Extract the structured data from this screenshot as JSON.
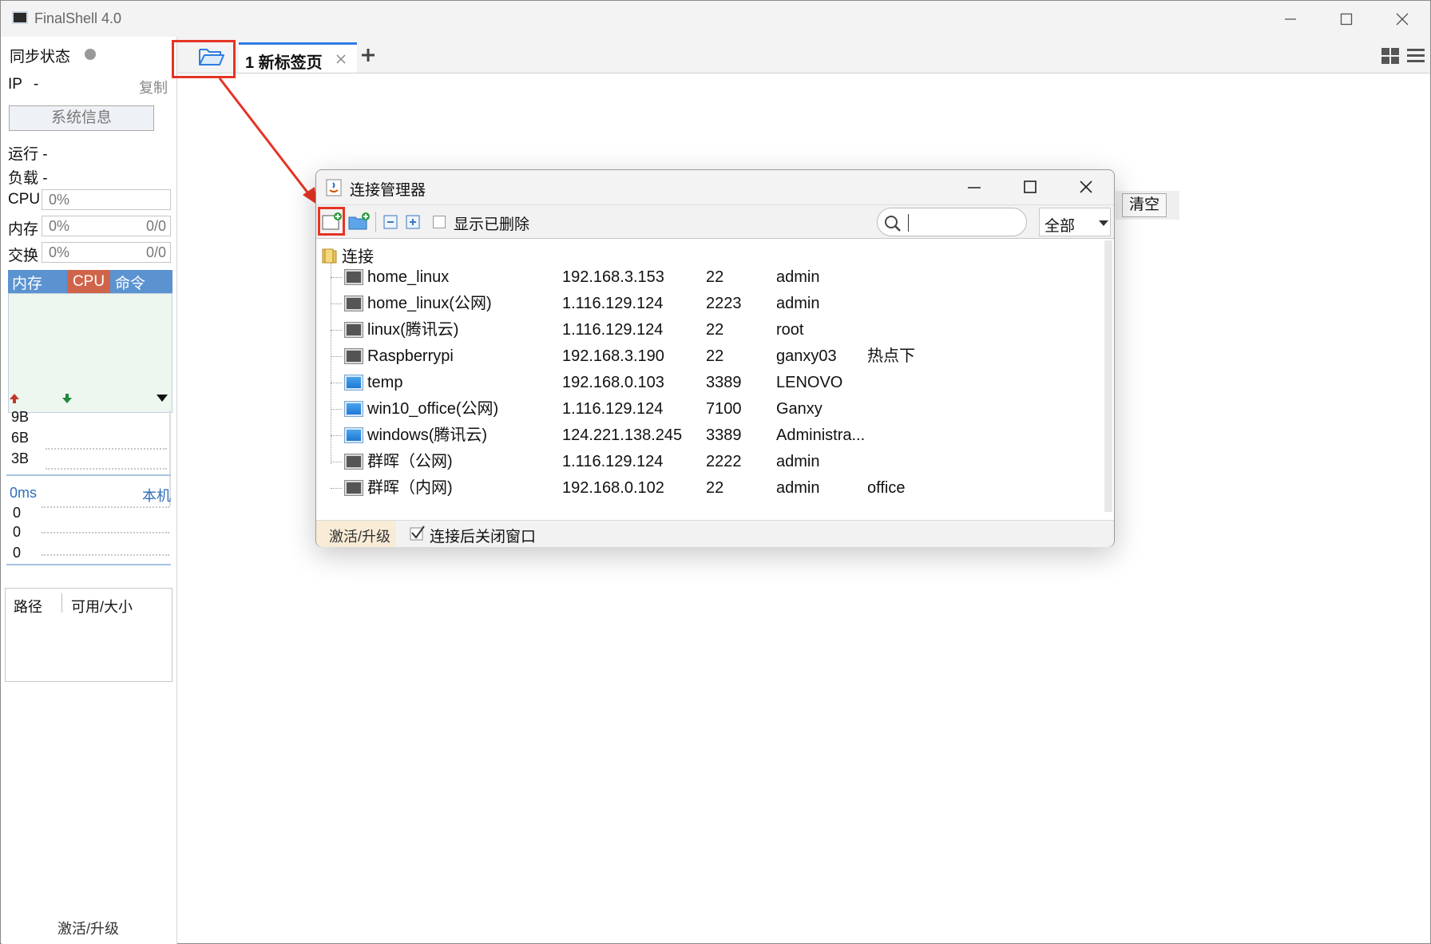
{
  "app": {
    "title": "FinalShell 4.0"
  },
  "sidebar": {
    "sync_label": "同步状态",
    "ip_label": "IP",
    "ip_value": "-",
    "copy_label": "复制",
    "sysinfo_button": "系统信息",
    "running_label": "运行 -",
    "load_label": "负载 -",
    "cpu_label": "CPU",
    "cpu_value": "0%",
    "mem_label": "内存",
    "mem_value": "0%",
    "mem_ratio": "0/0",
    "swap_label": "交换",
    "swap_value": "0%",
    "swap_ratio": "0/0",
    "monitor_tabs": [
      "内存",
      "CPU",
      "命令"
    ],
    "net_ticks": [
      "9B",
      "6B",
      "3B"
    ],
    "latency_label": "0ms",
    "local_label": "本机",
    "latency_values": [
      "0",
      "0",
      "0"
    ],
    "disk_headers": [
      "路径",
      "可用/大小"
    ],
    "activate_label": "激活/升级"
  },
  "tabs": {
    "active_tab_label": "1 新标签页"
  },
  "clear_button": "清空",
  "dialog": {
    "title": "连接管理器",
    "show_deleted_label": "显示已删除",
    "search_placeholder": "",
    "filter_value": "全部",
    "root_folder": "连接",
    "connections": [
      {
        "name": "home_linux",
        "host": "192.168.3.153",
        "port": "22",
        "user": "admin",
        "note": "",
        "type": "ssh"
      },
      {
        "name": "home_linux(公网)",
        "host": "1.116.129.124",
        "port": "2223",
        "user": "admin",
        "note": "",
        "type": "ssh"
      },
      {
        "name": "linux(腾讯云)",
        "host": "1.116.129.124",
        "port": "22",
        "user": "root",
        "note": "",
        "type": "ssh"
      },
      {
        "name": "Raspberrypi",
        "host": "192.168.3.190",
        "port": "22",
        "user": "ganxy03",
        "note": "热点下",
        "type": "ssh"
      },
      {
        "name": "temp",
        "host": "192.168.0.103",
        "port": "3389",
        "user": "LENOVO",
        "note": "",
        "type": "rdp"
      },
      {
        "name": "win10_office(公网)",
        "host": "1.116.129.124",
        "port": "7100",
        "user": "Ganxy",
        "note": "",
        "type": "rdp"
      },
      {
        "name": "windows(腾讯云)",
        "host": "124.221.138.245",
        "port": "3389",
        "user": "Administra...",
        "note": "",
        "type": "rdp"
      },
      {
        "name": "群晖（公网)",
        "host": "1.116.129.124",
        "port": "2222",
        "user": "admin",
        "note": "",
        "type": "ssh"
      },
      {
        "name": "群晖（内网)",
        "host": "192.168.0.102",
        "port": "22",
        "user": "admin",
        "note": "office",
        "type": "ssh"
      }
    ],
    "activate_label": "激活/升级",
    "close_after_connect_label": "连接后关闭窗口",
    "close_after_connect_checked": true
  },
  "colors": {
    "accent": "#2f7de0",
    "highlight_red": "#e53426",
    "monitor_tab_blue": "#5b93d1",
    "monitor_tab_cpu": "#d0644a"
  }
}
